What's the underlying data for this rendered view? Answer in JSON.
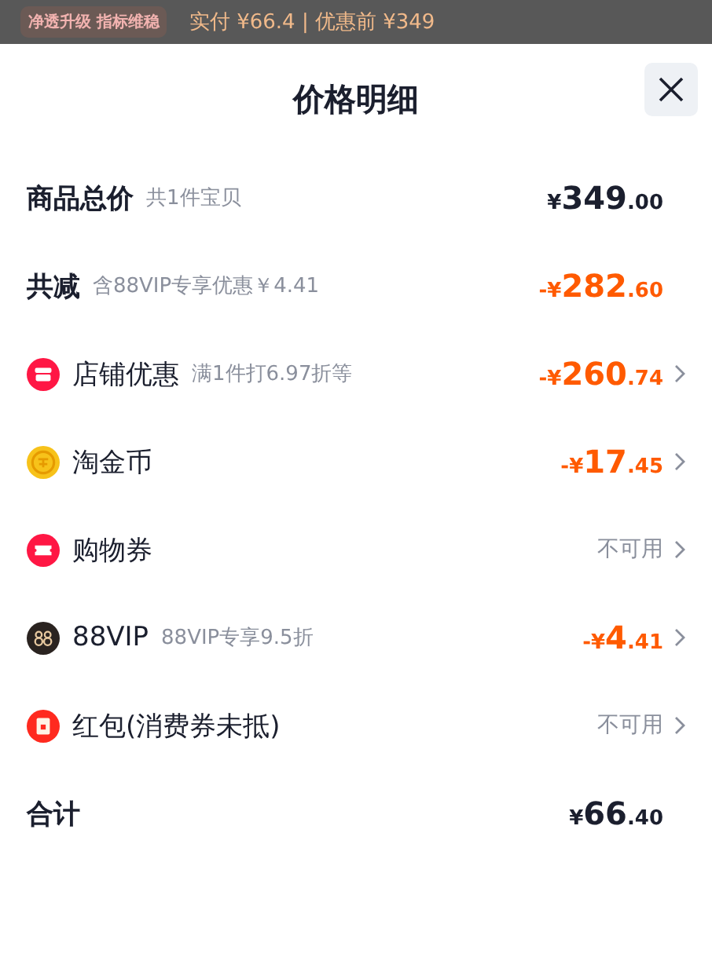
{
  "backdrop": {
    "badge": "净透升级 指标维稳",
    "summary": "实付 ¥66.4 | 优惠前 ¥349"
  },
  "sheet": {
    "title": "价格明细"
  },
  "rows": [
    {
      "kind": "header",
      "label": "商品总价",
      "note": "共1件宝贝",
      "value": {
        "kind": "plain",
        "prefix": "¥",
        "integer": "349",
        "decimal": ".00"
      }
    },
    {
      "kind": "header",
      "label": "共减",
      "note": "含88VIP专享优惠￥4.41",
      "value": {
        "kind": "discount",
        "prefix": "-¥",
        "integer": "282",
        "decimal": ".60"
      }
    },
    {
      "kind": "item",
      "label": "店铺优惠",
      "note": "满1件打6.97折等",
      "value": {
        "kind": "discount",
        "prefix": "-¥",
        "integer": "260",
        "decimal": ".74"
      }
    },
    {
      "kind": "item",
      "label": "淘金币",
      "value": {
        "kind": "discount",
        "prefix": "-¥",
        "integer": "17",
        "decimal": ".45"
      }
    },
    {
      "kind": "item",
      "label": "购物券",
      "value": {
        "kind": "unavailable",
        "text": "不可用"
      }
    },
    {
      "kind": "item",
      "label": "88VIP",
      "note": "88VIP专享9.5折",
      "value": {
        "kind": "discount",
        "prefix": "-¥",
        "integer": "4",
        "decimal": ".41"
      }
    },
    {
      "kind": "item",
      "label": "红包(消费券未抵)",
      "value": {
        "kind": "unavailable",
        "text": "不可用"
      }
    },
    {
      "kind": "header",
      "label": "合计",
      "value": {
        "kind": "plain",
        "prefix": "¥",
        "integer": "66",
        "decimal": ".40"
      }
    }
  ]
}
